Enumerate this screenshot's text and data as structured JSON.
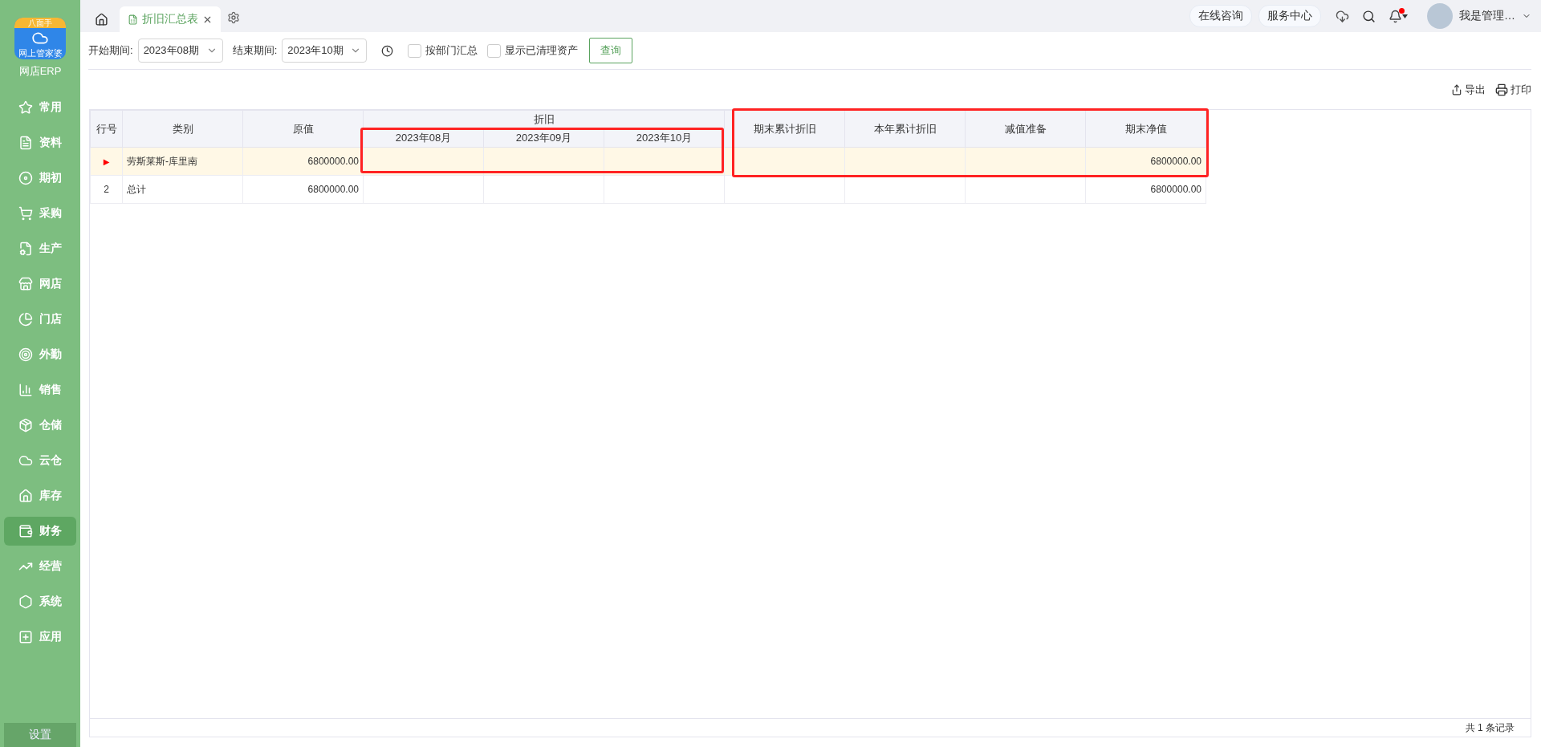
{
  "sidebar": {
    "logo": {
      "badge": "八面手",
      "caption": "网上管家婆"
    },
    "app_name": "网店ERP",
    "items": [
      {
        "kind": "star",
        "label": "常用",
        "selected": false
      },
      {
        "kind": "doc",
        "label": "资料",
        "selected": false
      },
      {
        "kind": "disc",
        "label": "期初",
        "selected": false
      },
      {
        "kind": "cart",
        "label": "采购",
        "selected": false
      },
      {
        "kind": "factory",
        "label": "生产",
        "selected": false
      },
      {
        "kind": "store",
        "label": "网店",
        "selected": false
      },
      {
        "kind": "pie",
        "label": "门店",
        "selected": false
      },
      {
        "kind": "target",
        "label": "外勤",
        "selected": false
      },
      {
        "kind": "chart",
        "label": "销售",
        "selected": false
      },
      {
        "kind": "box",
        "label": "仓储",
        "selected": false
      },
      {
        "kind": "cloud",
        "label": "云仓",
        "selected": false
      },
      {
        "kind": "home",
        "label": "库存",
        "selected": false
      },
      {
        "kind": "wallet",
        "label": "财务",
        "selected": true
      },
      {
        "kind": "trend",
        "label": "经营",
        "selected": false
      },
      {
        "kind": "hex",
        "label": "系统",
        "selected": false
      },
      {
        "kind": "plus",
        "label": "应用",
        "selected": false
      }
    ],
    "settings": "设置"
  },
  "tabs": [
    {
      "label": "折旧汇总表",
      "selected": true
    }
  ],
  "top_bar": {
    "buttons": [
      "在线咨询",
      "服务中心"
    ],
    "unread": true,
    "user": "我是管理…"
  },
  "filters": {
    "start_label": "开始期间:",
    "start_value": "2023年08期",
    "end_label": "结束期间:",
    "end_value": "2023年10期",
    "checkboxes": [
      {
        "label": "按部门汇总",
        "checked": false
      },
      {
        "label": "显示已清理资产",
        "checked": false
      }
    ],
    "query": "查询"
  },
  "actions": [
    {
      "kind": "export",
      "label": "导出"
    },
    {
      "kind": "print",
      "label": "打印"
    }
  ],
  "table": {
    "columns": [
      {
        "label": "行号"
      },
      {
        "label": "类别"
      },
      {
        "label": "原值"
      },
      {
        "label": "折旧",
        "children": [
          "2023年08月",
          "2023年09月",
          "2023年10月"
        ]
      },
      {
        "label": "期末累计折旧"
      },
      {
        "label": "本年累计折旧"
      },
      {
        "label": "减值准备"
      },
      {
        "label": "期末净值"
      }
    ],
    "rows": [
      {
        "selected": true,
        "cells": [
          "▶",
          "劳斯莱斯-库里南",
          "6800000.00",
          null,
          null,
          null,
          null,
          null,
          null,
          "6800000.00"
        ]
      },
      {
        "selected": false,
        "cells": [
          "2",
          "总计",
          "6800000.00",
          null,
          null,
          null,
          null,
          null,
          null,
          "6800000.00"
        ]
      }
    ],
    "footer": "共 1 条记录"
  }
}
